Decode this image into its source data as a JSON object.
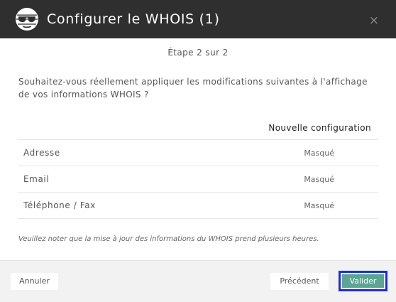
{
  "header": {
    "title": "Configurer le WHOIS (1)",
    "close_icon": "×",
    "logo_icon": "sunglasses-logo-icon"
  },
  "step": "Étape 2 sur 2",
  "question": "Souhaitez-vous réellement appliquer les modifications suivantes à l'affichage de vos informations WHOIS ?",
  "table": {
    "column_header": "Nouvelle configuration",
    "rows": [
      {
        "label": "Adresse",
        "value": "Masqué"
      },
      {
        "label": "Email",
        "value": "Masqué"
      },
      {
        "label": "Téléphone / Fax",
        "value": "Masqué"
      }
    ]
  },
  "note": "Veuillez noter que la mise à jour des informations du WHOIS prend plusieurs heures.",
  "footer": {
    "cancel_label": "Annuler",
    "previous_label": "Précédent",
    "validate_label": "Valider"
  },
  "colors": {
    "header_bg": "#2f2f2f",
    "validate_bg": "#5aa593",
    "focus_outline": "#1a2ed6",
    "footer_bg": "#f2f2f2"
  }
}
